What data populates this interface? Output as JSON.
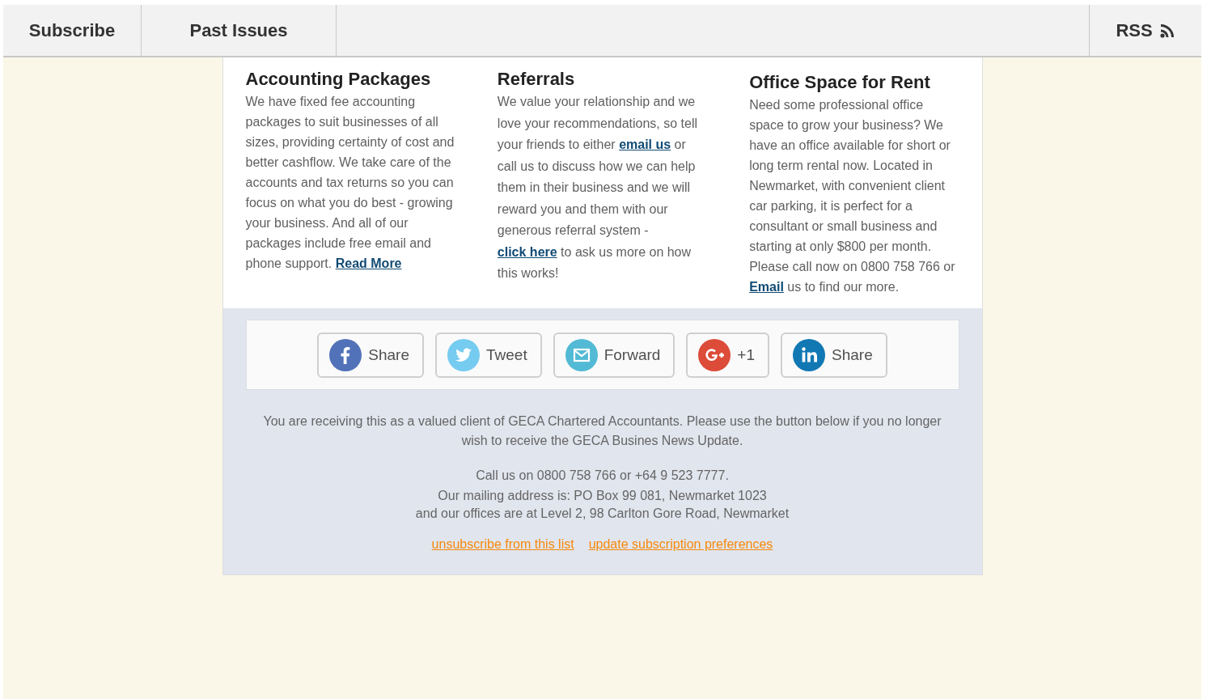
{
  "top_bar": {
    "links": [
      {
        "label": "Subscribe"
      },
      {
        "label": "Past Issues"
      }
    ],
    "rss": {
      "label": "RSS"
    }
  },
  "articles": [
    {
      "title": "Accounting Packages",
      "body": [
        {
          "kind": "text",
          "text": "We have fixed fee accounting packages to suit businesses of all sizes, providing certainty of cost and better cashflow. We take care of the accounts and tax returns so you can focus on what you do best - growing your business. And all of our packages include free email and phone support. "
        },
        {
          "kind": "link",
          "text": "Read More"
        }
      ]
    },
    {
      "title": "Referrals",
      "body": [
        {
          "kind": "text",
          "text": "We value your relationship and we love your recommendations, so tell your friends to either "
        },
        {
          "kind": "link",
          "text": "email us"
        },
        {
          "kind": "text",
          "text": " or call us to discuss how we can help them in their business and we will reward you and them with our generous referral system - "
        },
        {
          "kind": "link",
          "text": "click here"
        },
        {
          "kind": "text",
          "text": " to ask us more on how this works!"
        }
      ]
    },
    {
      "title": "Office Space for Rent",
      "body": [
        {
          "kind": "text",
          "text": "Need some professional office space to grow your business? We have an office available for short or long term rental now. Located in Newmarket, with convenient client car parking, it is perfect for a consultant or small business and starting at only $800 per month. Please call now on 0800 758 766 or "
        },
        {
          "kind": "link",
          "text": "Email"
        },
        {
          "kind": "text",
          "text": " us to find our more."
        }
      ]
    }
  ],
  "share_buttons": [
    {
      "kind": "facebook",
      "label": "Share"
    },
    {
      "kind": "twitter",
      "label": "Tweet"
    },
    {
      "kind": "email",
      "label": "Forward"
    },
    {
      "kind": "googleplus",
      "label": "+1"
    },
    {
      "kind": "linkedin",
      "label": "Share"
    }
  ],
  "footer": {
    "notice": "You are receiving this as a valued client of GECA Chartered Accountants. Please use the button below if you no longer wish to receive the GECA Busines News Update.",
    "phone_line": "Call us on 0800 758 766 or +64 9 523 7777.",
    "address_lines": [
      "Our mailing address is: PO Box 99 081, Newmarket 1023",
      "and our offices are at Level 2, 98 Carlton Gore Road, Newmarket"
    ],
    "links": [
      {
        "label": "unsubscribe from this list"
      },
      {
        "label": "update subscription preferences"
      }
    ]
  }
}
